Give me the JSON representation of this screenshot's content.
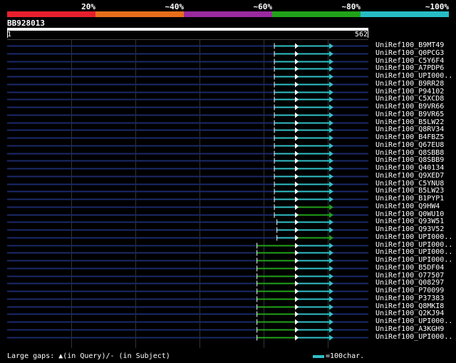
{
  "legend": [
    {
      "label": "20%",
      "color": "#e8202e"
    },
    {
      "label": "~40%",
      "color": "#e86e1c"
    },
    {
      "label": "~60%",
      "color": "#9a2aa0"
    },
    {
      "label": "~80%",
      "color": "#21a21a"
    },
    {
      "label": "~100%",
      "color": "#27bcc6"
    }
  ],
  "query": {
    "name": "BB928013",
    "start": "1",
    "end": "562"
  },
  "colors": {
    "cyan": "#31c0c8",
    "green": "#21a21a",
    "navy": "#1a2a6a",
    "black": "#000000"
  },
  "hits": [
    {
      "label": "UniRef100_B9MT49",
      "color": "cyan",
      "start": 416,
      "end": 562
    },
    {
      "label": "UniRef100_Q0PCG3",
      "color": "cyan",
      "start": 416,
      "end": 562
    },
    {
      "label": "UniRef100_C5Y6F4",
      "color": "cyan",
      "start": 416,
      "end": 562
    },
    {
      "label": "UniRef100_A7PDP6",
      "color": "cyan",
      "start": 416,
      "end": 562
    },
    {
      "label": "UniRef100_UPI000..",
      "color": "cyan",
      "start": 416,
      "end": 562
    },
    {
      "label": "UniRef100_B9RR28",
      "color": "cyan",
      "start": 416,
      "end": 562
    },
    {
      "label": "UniRef100_P94102",
      "color": "cyan",
      "start": 416,
      "end": 562
    },
    {
      "label": "UniRef100_C5XCD8",
      "color": "cyan",
      "start": 416,
      "end": 562
    },
    {
      "label": "UniRef100_B9VR66",
      "color": "cyan",
      "start": 416,
      "end": 562
    },
    {
      "label": "UniRef100_B9VR65",
      "color": "cyan",
      "start": 416,
      "end": 562
    },
    {
      "label": "UniRef100_B5LW22",
      "color": "cyan",
      "start": 416,
      "end": 562
    },
    {
      "label": "UniRef100_Q8RV34",
      "color": "cyan",
      "start": 416,
      "end": 562
    },
    {
      "label": "UniRef100_B4FBZ5",
      "color": "cyan",
      "start": 416,
      "end": 562
    },
    {
      "label": "UniRef100_Q67EU8",
      "color": "cyan",
      "start": 416,
      "end": 562
    },
    {
      "label": "UniRef100_Q8SBB8",
      "color": "cyan",
      "start": 416,
      "end": 562
    },
    {
      "label": "UniRef100_Q8SBB9",
      "color": "cyan",
      "start": 416,
      "end": 562
    },
    {
      "label": "UniRef100_Q40134",
      "color": "cyan",
      "start": 416,
      "end": 562
    },
    {
      "label": "UniRef100_Q9XED7",
      "color": "cyan",
      "start": 416,
      "end": 562
    },
    {
      "label": "UniRef100_C5YNU8",
      "color": "cyan",
      "start": 416,
      "end": 562
    },
    {
      "label": "UniRef100_B5LW23",
      "color": "cyan",
      "start": 416,
      "end": 562
    },
    {
      "label": "UniRef100_B1PYP1",
      "color": "cyan",
      "start": 416,
      "end": 562
    },
    {
      "label": "UniRef100_Q9HW4",
      "color": "mixed",
      "start": 416,
      "end": 562
    },
    {
      "label": "UniRef100_Q0WU10",
      "color": "mixed",
      "start": 416,
      "end": 562
    },
    {
      "label": "UniRef100_Q93W51",
      "color": "cyan",
      "start": 420,
      "end": 562
    },
    {
      "label": "UniRef100_Q93V52",
      "color": "cyan",
      "start": 420,
      "end": 562
    },
    {
      "label": "UniRef100_UPI000..",
      "color": "mixed2",
      "start": 420,
      "end": 562
    },
    {
      "label": "UniRef100_UPI000..",
      "color": "mixed3",
      "start": 389,
      "end": 562
    },
    {
      "label": "UniRef100_UPI000..",
      "color": "mixed3",
      "start": 389,
      "end": 562
    },
    {
      "label": "UniRef100_UPI000..",
      "color": "mixed3",
      "start": 389,
      "end": 562
    },
    {
      "label": "UniRef100_B5DF04",
      "color": "mixed3",
      "start": 389,
      "end": 562
    },
    {
      "label": "UniRef100_O77507",
      "color": "mixed3",
      "start": 389,
      "end": 562
    },
    {
      "label": "UniRef100_Q08297",
      "color": "mixed3",
      "start": 389,
      "end": 562
    },
    {
      "label": "UniRef100_P70099",
      "color": "mixed3",
      "start": 389,
      "end": 562
    },
    {
      "label": "UniRef100_P37383",
      "color": "mixed3",
      "start": 389,
      "end": 562
    },
    {
      "label": "UniRef100_Q8MKI8",
      "color": "mixed3",
      "start": 389,
      "end": 562
    },
    {
      "label": "UniRef100_Q2KJ94",
      "color": "mixed3",
      "start": 389,
      "end": 562
    },
    {
      "label": "UniRef100_UPI000..",
      "color": "mixed3",
      "start": 389,
      "end": 562
    },
    {
      "label": "UniRef100_A3KGH9",
      "color": "mixed3",
      "start": 389,
      "end": 562
    },
    {
      "label": "UniRef100_UPI000..",
      "color": "mixed3",
      "start": 389,
      "end": 562
    }
  ],
  "footer": {
    "gaps_text": "Large gaps: ▲(in Query)/- (in Subject)",
    "scale_text": "=100char."
  }
}
